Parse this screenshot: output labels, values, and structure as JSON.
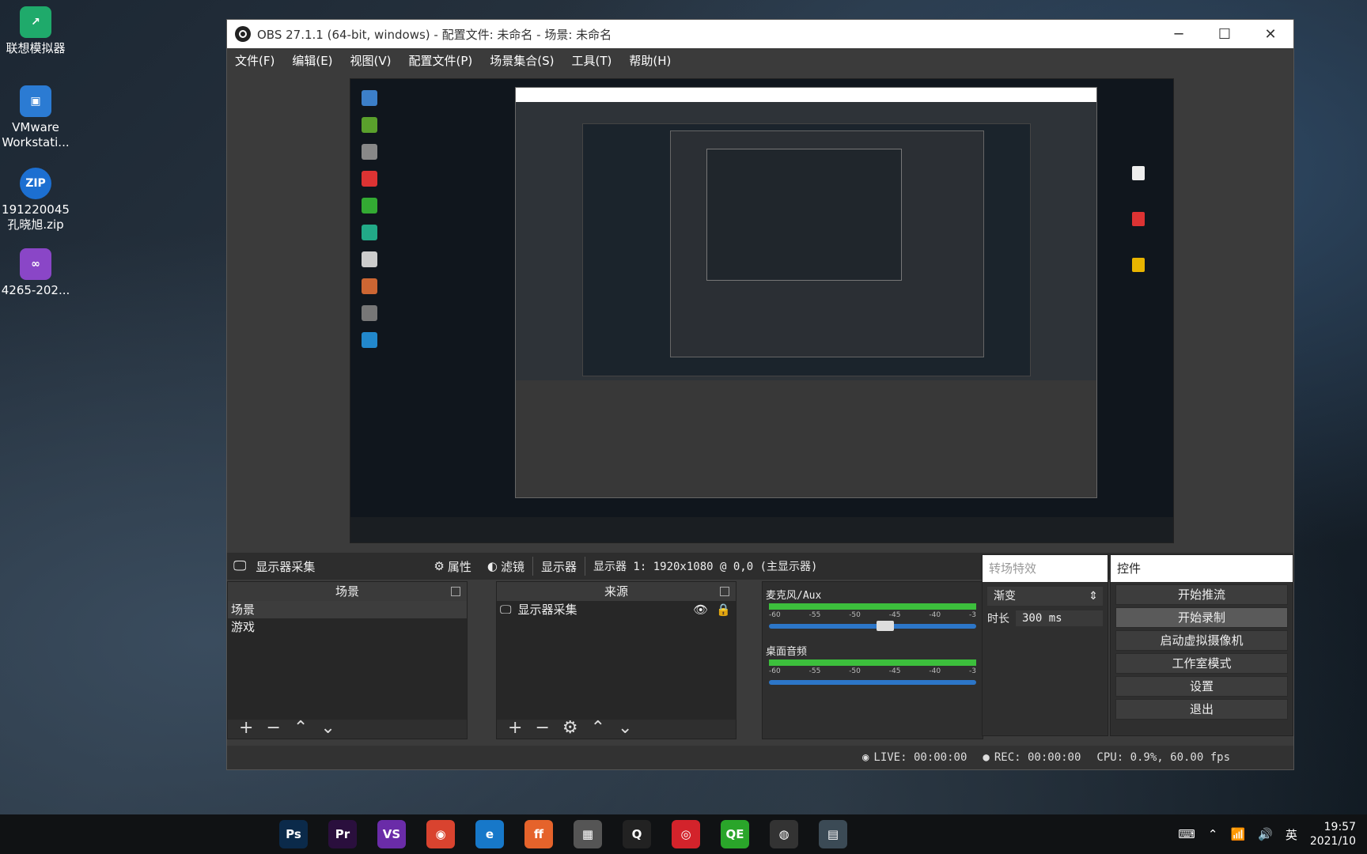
{
  "desktop": {
    "icons": [
      {
        "label": "联想模拟器",
        "icon": "lenovo-emulator-icon",
        "color": "#1faa6b"
      },
      {
        "label": "VMware Workstati...",
        "icon": "vmware-icon",
        "color": "#2b7bd3"
      },
      {
        "label": "191220045 孔晓旭.zip",
        "icon": "zip-icon",
        "color": "#1c6fd1"
      },
      {
        "label": "4265-202...",
        "icon": "visual-studio-icon",
        "color": "#8a46c7"
      }
    ]
  },
  "window": {
    "title": "OBS 27.1.1 (64-bit, windows) - 配置文件: 未命名 - 场景: 未命名",
    "controls": [
      "─",
      "☐",
      "✕"
    ],
    "menu": [
      "文件(F)",
      "编辑(E)",
      "视图(V)",
      "配置文件(P)",
      "场景集合(S)",
      "工具(T)",
      "帮助(H)"
    ]
  },
  "source_toolbar": {
    "source_name": "显示器采集",
    "properties": "属性",
    "filters": "滤镜",
    "display_label": "显示器",
    "display_value": "显示器 1: 1920x1080 @ 0,0 (主显示器)"
  },
  "scenes": {
    "title": "场景",
    "items": [
      "场景",
      "游戏"
    ]
  },
  "sources": {
    "title": "来源",
    "items": [
      "显示器采集"
    ]
  },
  "mixer": {
    "channels": [
      {
        "name": "麦克风/Aux",
        "ticks": [
          "-60",
          "-55",
          "-50",
          "-45",
          "-40",
          "-3"
        ],
        "volume": 0.52
      },
      {
        "name": "桌面音频",
        "ticks": [
          "-60",
          "-55",
          "-50",
          "-45",
          "-40",
          "-3"
        ],
        "volume": 1.0
      }
    ]
  },
  "transitions": {
    "title": "转场特效",
    "selected": "渐变",
    "duration_label": "时长",
    "duration_value": "300 ms"
  },
  "controls": {
    "title": "控件",
    "buttons": [
      "开始推流",
      "开始录制",
      "启动虚拟摄像机",
      "工作室模式",
      "设置",
      "退出"
    ]
  },
  "status": {
    "live": "LIVE: 00:00:00",
    "rec": "REC: 00:00:00",
    "cpu": "CPU: 0.9%, 60.00 fps"
  },
  "taskbar": {
    "apps": [
      {
        "icon": "photoshop-icon",
        "text": "Ps",
        "color": "#0b2a4a"
      },
      {
        "icon": "premiere-icon",
        "text": "Pr",
        "color": "#2a0f3d"
      },
      {
        "icon": "visual-studio-icon",
        "text": "VS",
        "color": "#6a2ca8"
      },
      {
        "icon": "chrome-icon",
        "text": "◉",
        "color": "#d9432f"
      },
      {
        "icon": "edge-icon",
        "text": "e",
        "color": "#1778c9"
      },
      {
        "icon": "firefox-icon",
        "text": "ff",
        "color": "#e5632b"
      },
      {
        "icon": "store-icon",
        "text": "▦",
        "color": "#555"
      },
      {
        "icon": "qq-icon",
        "text": "Q",
        "color": "#222"
      },
      {
        "icon": "netease-music-icon",
        "text": "◎",
        "color": "#d3232b"
      },
      {
        "icon": "wechat-icon",
        "text": "QE",
        "color": "#2aa52a"
      },
      {
        "icon": "obs-icon",
        "text": "◍",
        "color": "#333"
      },
      {
        "icon": "terminal-icon",
        "text": "▤",
        "color": "#3b4a55"
      }
    ],
    "tray": [
      "英"
    ],
    "time": "19:57",
    "date": "2021/10"
  }
}
